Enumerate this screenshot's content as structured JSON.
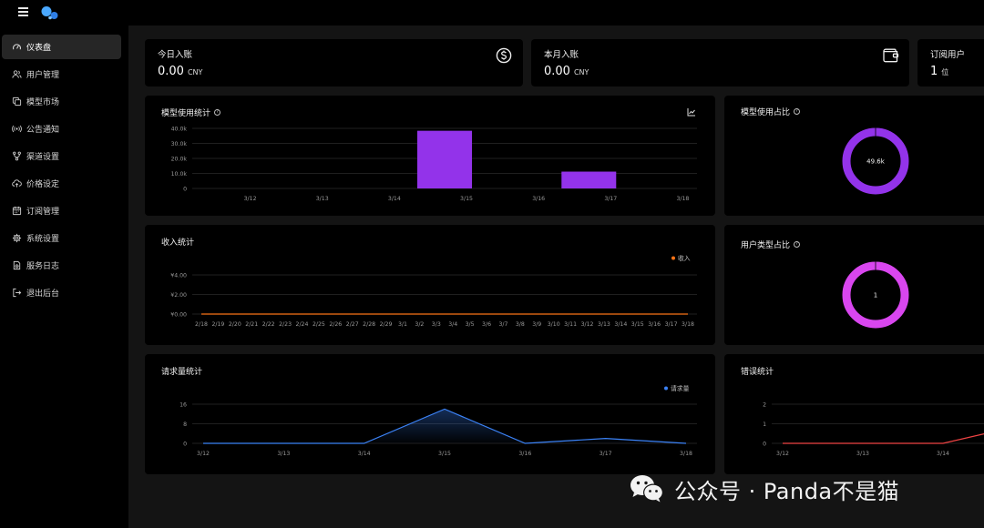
{
  "nav": {
    "items": [
      {
        "label": "仪表盘",
        "icon": "gauge-icon",
        "active": true
      },
      {
        "label": "用户管理",
        "icon": "users-icon"
      },
      {
        "label": "模型市场",
        "icon": "copy-icon"
      },
      {
        "label": "公告通知",
        "icon": "broadcast-icon"
      },
      {
        "label": "渠道设置",
        "icon": "branch-icon"
      },
      {
        "label": "价格设定",
        "icon": "cloud-upload-icon"
      },
      {
        "label": "订阅管理",
        "icon": "calendar-icon"
      },
      {
        "label": "系统设置",
        "icon": "gear-icon"
      },
      {
        "label": "服务日志",
        "icon": "log-file-icon"
      },
      {
        "label": "退出后台",
        "icon": "logout-icon"
      }
    ]
  },
  "stats": {
    "today": {
      "label": "今日入账",
      "value": "0.00",
      "unit": "CNY",
      "icon": "dollar-circle-icon"
    },
    "month": {
      "label": "本月入账",
      "value": "0.00",
      "unit": "CNY",
      "icon": "wallet-icon"
    },
    "subs": {
      "label": "订阅用户",
      "value": "1",
      "unit": "位"
    }
  },
  "cards": {
    "model_usage": "模型使用统计",
    "model_share": "模型使用占比",
    "income": "收入统计",
    "user_type": "用户类型占比",
    "requests": "请求量统计",
    "errors": "错误统计"
  },
  "colors": {
    "purple": "#9333ea",
    "magenta": "#d946ef",
    "orange": "#f97316",
    "blue": "#3b82f6",
    "red": "#ef4444"
  },
  "watermark": {
    "text": "公众号 · Panda不是猫",
    "icon": "wechat-icon"
  },
  "chart_data": [
    {
      "type": "bar",
      "title": "模型使用统计",
      "categories": [
        "3/12",
        "3/13",
        "3/14",
        "3/15",
        "3/16",
        "3/17",
        "3/18"
      ],
      "values": [
        0,
        0,
        0,
        38400,
        0,
        11200,
        0
      ],
      "yticks": [
        "0",
        "10.0k",
        "20.0k",
        "30.0k",
        "40.0k"
      ],
      "ylim": [
        0,
        40000
      ],
      "color": "#9333ea"
    },
    {
      "type": "pie",
      "title": "模型使用占比",
      "values": [
        49600
      ],
      "labels": [
        "49.6k"
      ],
      "color": "#9333ea"
    },
    {
      "type": "line",
      "title": "收入统计",
      "x": [
        "2/18",
        "2/19",
        "2/20",
        "2/21",
        "2/22",
        "2/23",
        "2/24",
        "2/25",
        "2/26",
        "2/27",
        "2/28",
        "2/29",
        "3/1",
        "3/2",
        "3/3",
        "3/4",
        "3/5",
        "3/6",
        "3/7",
        "3/8",
        "3/9",
        "3/10",
        "3/11",
        "3/12",
        "3/13",
        "3/14",
        "3/15",
        "3/16",
        "3/17",
        "3/18"
      ],
      "series": [
        {
          "name": "收入",
          "values": [
            0,
            0,
            0,
            0,
            0,
            0,
            0,
            0,
            0,
            0,
            0,
            0,
            0,
            0,
            0,
            0,
            0,
            0,
            0,
            0,
            0,
            0,
            0,
            0,
            0,
            0,
            0,
            0,
            0,
            0
          ]
        }
      ],
      "yticks": [
        "¥0.00",
        "¥2.00",
        "¥4.00"
      ],
      "ylim": [
        0,
        4
      ],
      "legend": "top-right",
      "color": "#f97316"
    },
    {
      "type": "pie",
      "title": "用户类型占比",
      "values": [
        1
      ],
      "labels": [
        "1"
      ],
      "color": "#d946ef"
    },
    {
      "type": "area",
      "title": "请求量统计",
      "x": [
        "3/12",
        "3/13",
        "3/14",
        "3/15",
        "3/16",
        "3/17",
        "3/18"
      ],
      "series": [
        {
          "name": "请求量",
          "values": [
            0,
            0,
            0,
            14,
            0,
            2,
            0
          ]
        }
      ],
      "yticks": [
        "0",
        "8",
        "16"
      ],
      "ylim": [
        0,
        16
      ],
      "legend": "top-right",
      "color": "#3b82f6"
    },
    {
      "type": "line",
      "title": "错误统计",
      "x": [
        "3/12",
        "3/13",
        "3/14"
      ],
      "series": [
        {
          "values": [
            0,
            0,
            0
          ]
        }
      ],
      "yticks": [
        "0",
        "1",
        "2"
      ],
      "ylim": [
        0,
        2
      ],
      "color": "#ef4444"
    }
  ]
}
